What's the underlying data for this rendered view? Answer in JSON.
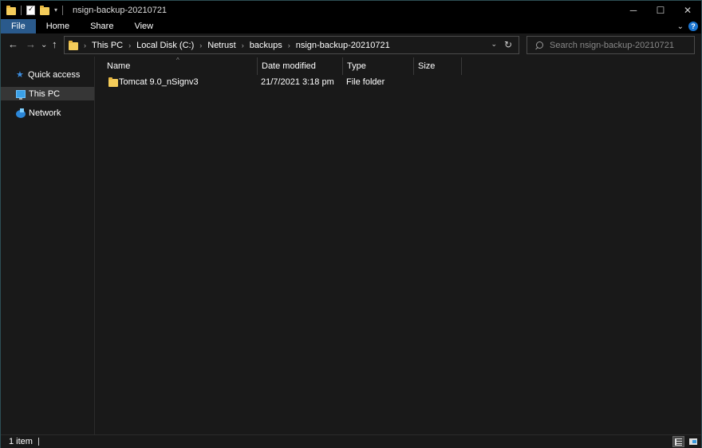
{
  "window": {
    "title": "nsign-backup-20210721",
    "controls": {
      "minimize": "─",
      "maximize": "☐",
      "close": "✕"
    }
  },
  "ribbon": {
    "tabs": [
      {
        "label": "File",
        "active": true
      },
      {
        "label": "Home",
        "active": false
      },
      {
        "label": "Share",
        "active": false
      },
      {
        "label": "View",
        "active": false
      }
    ],
    "expand_glyph": "⌄",
    "help_glyph": "?"
  },
  "nav": {
    "back": "←",
    "forward": "→",
    "recent": "⌄",
    "up": "↑",
    "breadcrumb": [
      "This PC",
      "Local Disk (C:)",
      "Netrust",
      "backups",
      "nsign-backup-20210721"
    ],
    "crumb_separator": "›",
    "dropdown_glyph": "⌄",
    "refresh_glyph": "↻",
    "search_placeholder": "Search nsign-backup-20210721"
  },
  "sidebar": {
    "items": [
      {
        "label": "Quick access",
        "icon": "star-icon",
        "selected": false
      },
      {
        "label": "This PC",
        "icon": "computer-icon",
        "selected": true
      },
      {
        "label": "Network",
        "icon": "network-icon",
        "selected": false
      }
    ]
  },
  "columns": {
    "sort_indicator": "^",
    "headers": [
      "Name",
      "Date modified",
      "Type",
      "Size"
    ]
  },
  "files": [
    {
      "name": "Tomcat 9.0_nSignv3",
      "date_modified": "21/7/2021 3:18 pm",
      "type": "File folder",
      "size": ""
    }
  ],
  "status": {
    "item_count": "1 item"
  },
  "colors": {
    "background": "#191919",
    "titlebar": "#000000",
    "active_tab": "#2a5a8c",
    "selection": "#363636",
    "folder": "#f4cc5a",
    "accent": "#1a74d0"
  }
}
